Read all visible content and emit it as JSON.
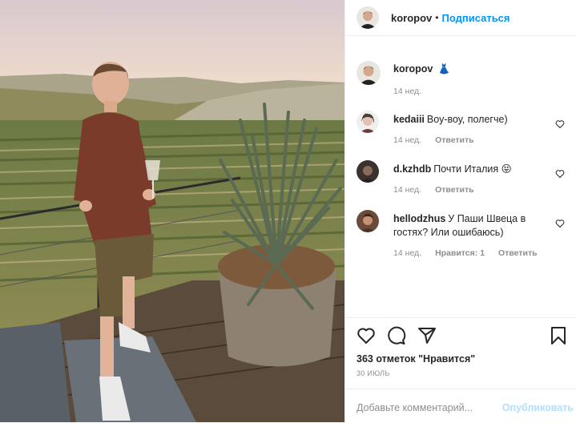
{
  "post": {
    "author": "koropov",
    "dot": "•",
    "follow_label": "Подписаться",
    "caption_emoji": "👗",
    "caption_time": "14 нед."
  },
  "comments": [
    {
      "user": "kedaiii",
      "text": "Воу-воу, полегче)",
      "time": "14 нед.",
      "reply": "Ответить"
    },
    {
      "user": "d.kzhdb",
      "text": "Почти Италия 😝",
      "time": "14 нед.",
      "reply": "Ответить"
    },
    {
      "user": "hellodzhus",
      "text": "У Паши Швеца в гостях? Или ошибаюсь)",
      "time": "14 нед.",
      "likes": "Нравится: 1",
      "reply": "Ответить"
    }
  ],
  "footer": {
    "likes": "363 отметок \"Нравится\"",
    "date": "30 ИЮЛЬ",
    "add_comment_placeholder": "Добавьте комментарий...",
    "publish_label": "Опубликовать"
  },
  "icons": {
    "like": "heart-icon",
    "comment": "comment-icon",
    "share": "paper-plane-icon",
    "save": "bookmark-icon"
  }
}
